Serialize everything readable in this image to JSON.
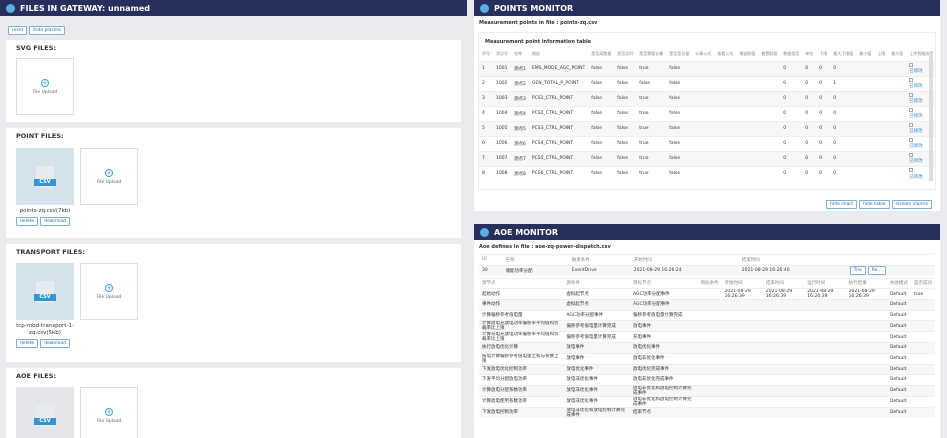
{
  "files": {
    "title": "FILES IN GATEWAY: unnamed",
    "buttons": [
      "reset",
      "hide plasma"
    ],
    "upload_label": "File Upload",
    "file_badge": "CSV",
    "delete": "delete",
    "download": "download",
    "svg_title": "SVG FILES:",
    "point_title": "POINT FILES:",
    "point_file": "points-zq.csv(7kb)",
    "transport_title": "TRANSPORT FILES:",
    "transport_file": "tcp-mbd-transport-1-zq.csv(5kb)",
    "aoe_title": "AOE FILES:"
  },
  "points": {
    "title": "POINTS MONITOR",
    "subtitle": "Measurement points in file : points-zq.csv",
    "table_title": "Measurement point information table",
    "headers": [
      "序号",
      "测点号",
      "名称",
      "描述",
      "是否离散量",
      "是否实时",
      "是否需要计算",
      "是否是总量",
      "计算公式",
      "查看公式",
      "增益取值",
      "偏置取值",
      "数据类型",
      "单位",
      "下限",
      "最大下限值",
      "最小值",
      "上限",
      "最大值",
      "上传到服务端"
    ],
    "rows": [
      [
        "1",
        "1001",
        "测点1",
        "EMS_MODE_AGC_POINT",
        "false",
        "false",
        "true",
        "false",
        "0",
        "0",
        "0",
        "0",
        ""
      ],
      [
        "2",
        "1002",
        "测点2",
        "GEN_TOTAL_P_POINT",
        "false",
        "false",
        "false",
        "false",
        "0",
        "0",
        "0",
        "1",
        ""
      ],
      [
        "3",
        "1003",
        "测点3",
        "PCS1_CTRL_POINT",
        "false",
        "false",
        "true",
        "false",
        "0",
        "0",
        "0",
        "0",
        ""
      ],
      [
        "4",
        "1004",
        "测点4",
        "PCS2_CTRL_POINT",
        "false",
        "false",
        "true",
        "false",
        "0",
        "0",
        "0",
        "0",
        ""
      ],
      [
        "5",
        "1005",
        "测点5",
        "PCS3_CTRL_POINT",
        "false",
        "false",
        "true",
        "false",
        "0",
        "0",
        "0",
        "0",
        ""
      ],
      [
        "6",
        "1006",
        "测点6",
        "PCS4_CTRL_POINT",
        "false",
        "false",
        "true",
        "false",
        "0",
        "0",
        "0",
        "0",
        ""
      ],
      [
        "7",
        "1007",
        "测点7",
        "PCS5_CTRL_POINT",
        "false",
        "false",
        "true",
        "false",
        "0",
        "0",
        "0",
        "0",
        ""
      ],
      [
        "8",
        "1008",
        "测点8",
        "PCS6_CTRL_POINT",
        "false",
        "false",
        "true",
        "false",
        "0",
        "0",
        "0",
        "0",
        ""
      ]
    ],
    "link": "已修改",
    "buttons": [
      "hide chart",
      "hide table",
      "stream alarms"
    ]
  },
  "aoe": {
    "title": "AOE MONITOR",
    "subtitle": "Aoe defines in file : aoe-zq-power-dispatch.csv",
    "top_headers": [
      "ID",
      "名称",
      "触发条件",
      "开始时间",
      "结束时间"
    ],
    "top_row": [
      "30",
      "储能功率分配",
      "EventDrive",
      "2021-08-29 16:26:24",
      "2021-08-29 16:26:40"
    ],
    "top_buttons": [
      "Trie",
      "Re..."
    ],
    "headers": [
      "源节点",
      "源条件",
      "目标节点",
      "目标条件",
      "开始时间",
      "结束时间",
      "运行时间",
      "执行结果",
      "失败模式",
      "是否成功"
    ],
    "rows": [
      [
        "起始动作",
        "虚拟起节点",
        "AGC功率分配事件",
        "",
        "2021-08-29 16:26:39",
        "2021-08-29 16:26:39",
        "2021-08-29 16:26:39",
        "2021-08-29 16:26:39",
        "Default",
        "true"
      ],
      [
        "事件动作",
        "虚拟起节点",
        "AGC功率分配事件",
        "",
        "",
        "",
        "",
        "",
        "Default",
        ""
      ],
      [
        "计算偏移参考值电量",
        "AGC功率分配事件",
        "偏移参考值电量计算完成",
        "",
        "",
        "",
        "",
        "",
        "Default",
        ""
      ],
      [
        "计算放电充放电功率偏移率平均值和负载率比上限",
        "偏移参考值电量计算完成",
        "放电事件",
        "",
        "",
        "",
        "",
        "",
        "Default",
        ""
      ],
      [
        "计算充电充放电功率偏移率平均值和负载率比上限",
        "偏移参考值电量计算完成",
        "充电事件",
        "",
        "",
        "",
        "",
        "",
        "Default",
        ""
      ],
      [
        "执行放电优化计算",
        "放电事件",
        "放电优化事件",
        "",
        "",
        "",
        "",
        "",
        "Default",
        ""
      ],
      [
        "按电计算偏移参考值电量之和与系数上限",
        "放电事件",
        "放电非优化事件",
        "",
        "",
        "",
        "",
        "",
        "Default",
        ""
      ],
      [
        "下发放电优化控制功率",
        "放电优化事件",
        "放电优化完成事件",
        "",
        "",
        "",
        "",
        "",
        "Default",
        ""
      ],
      [
        "下发平均分配放电功率",
        "放电非优化事件",
        "放电非优化完成事件",
        "",
        "",
        "",
        "",
        "",
        "Default",
        ""
      ],
      [
        "计算放电分配系数功率",
        "放电非优化事件",
        "放电非优化和放电控制计算完成事件",
        "",
        "",
        "",
        "",
        "",
        "Default",
        ""
      ],
      [
        "计算放电使用系数功率",
        "放电非优化事件",
        "放电非优化和放电控制计算完成事件",
        "",
        "",
        "",
        "",
        "",
        "Default",
        ""
      ],
      [
        "下发放电控制功率",
        "放电非优化和放电控制计算完成事件",
        "结束节点",
        "",
        "",
        "",
        "",
        "",
        "Default",
        ""
      ]
    ]
  }
}
